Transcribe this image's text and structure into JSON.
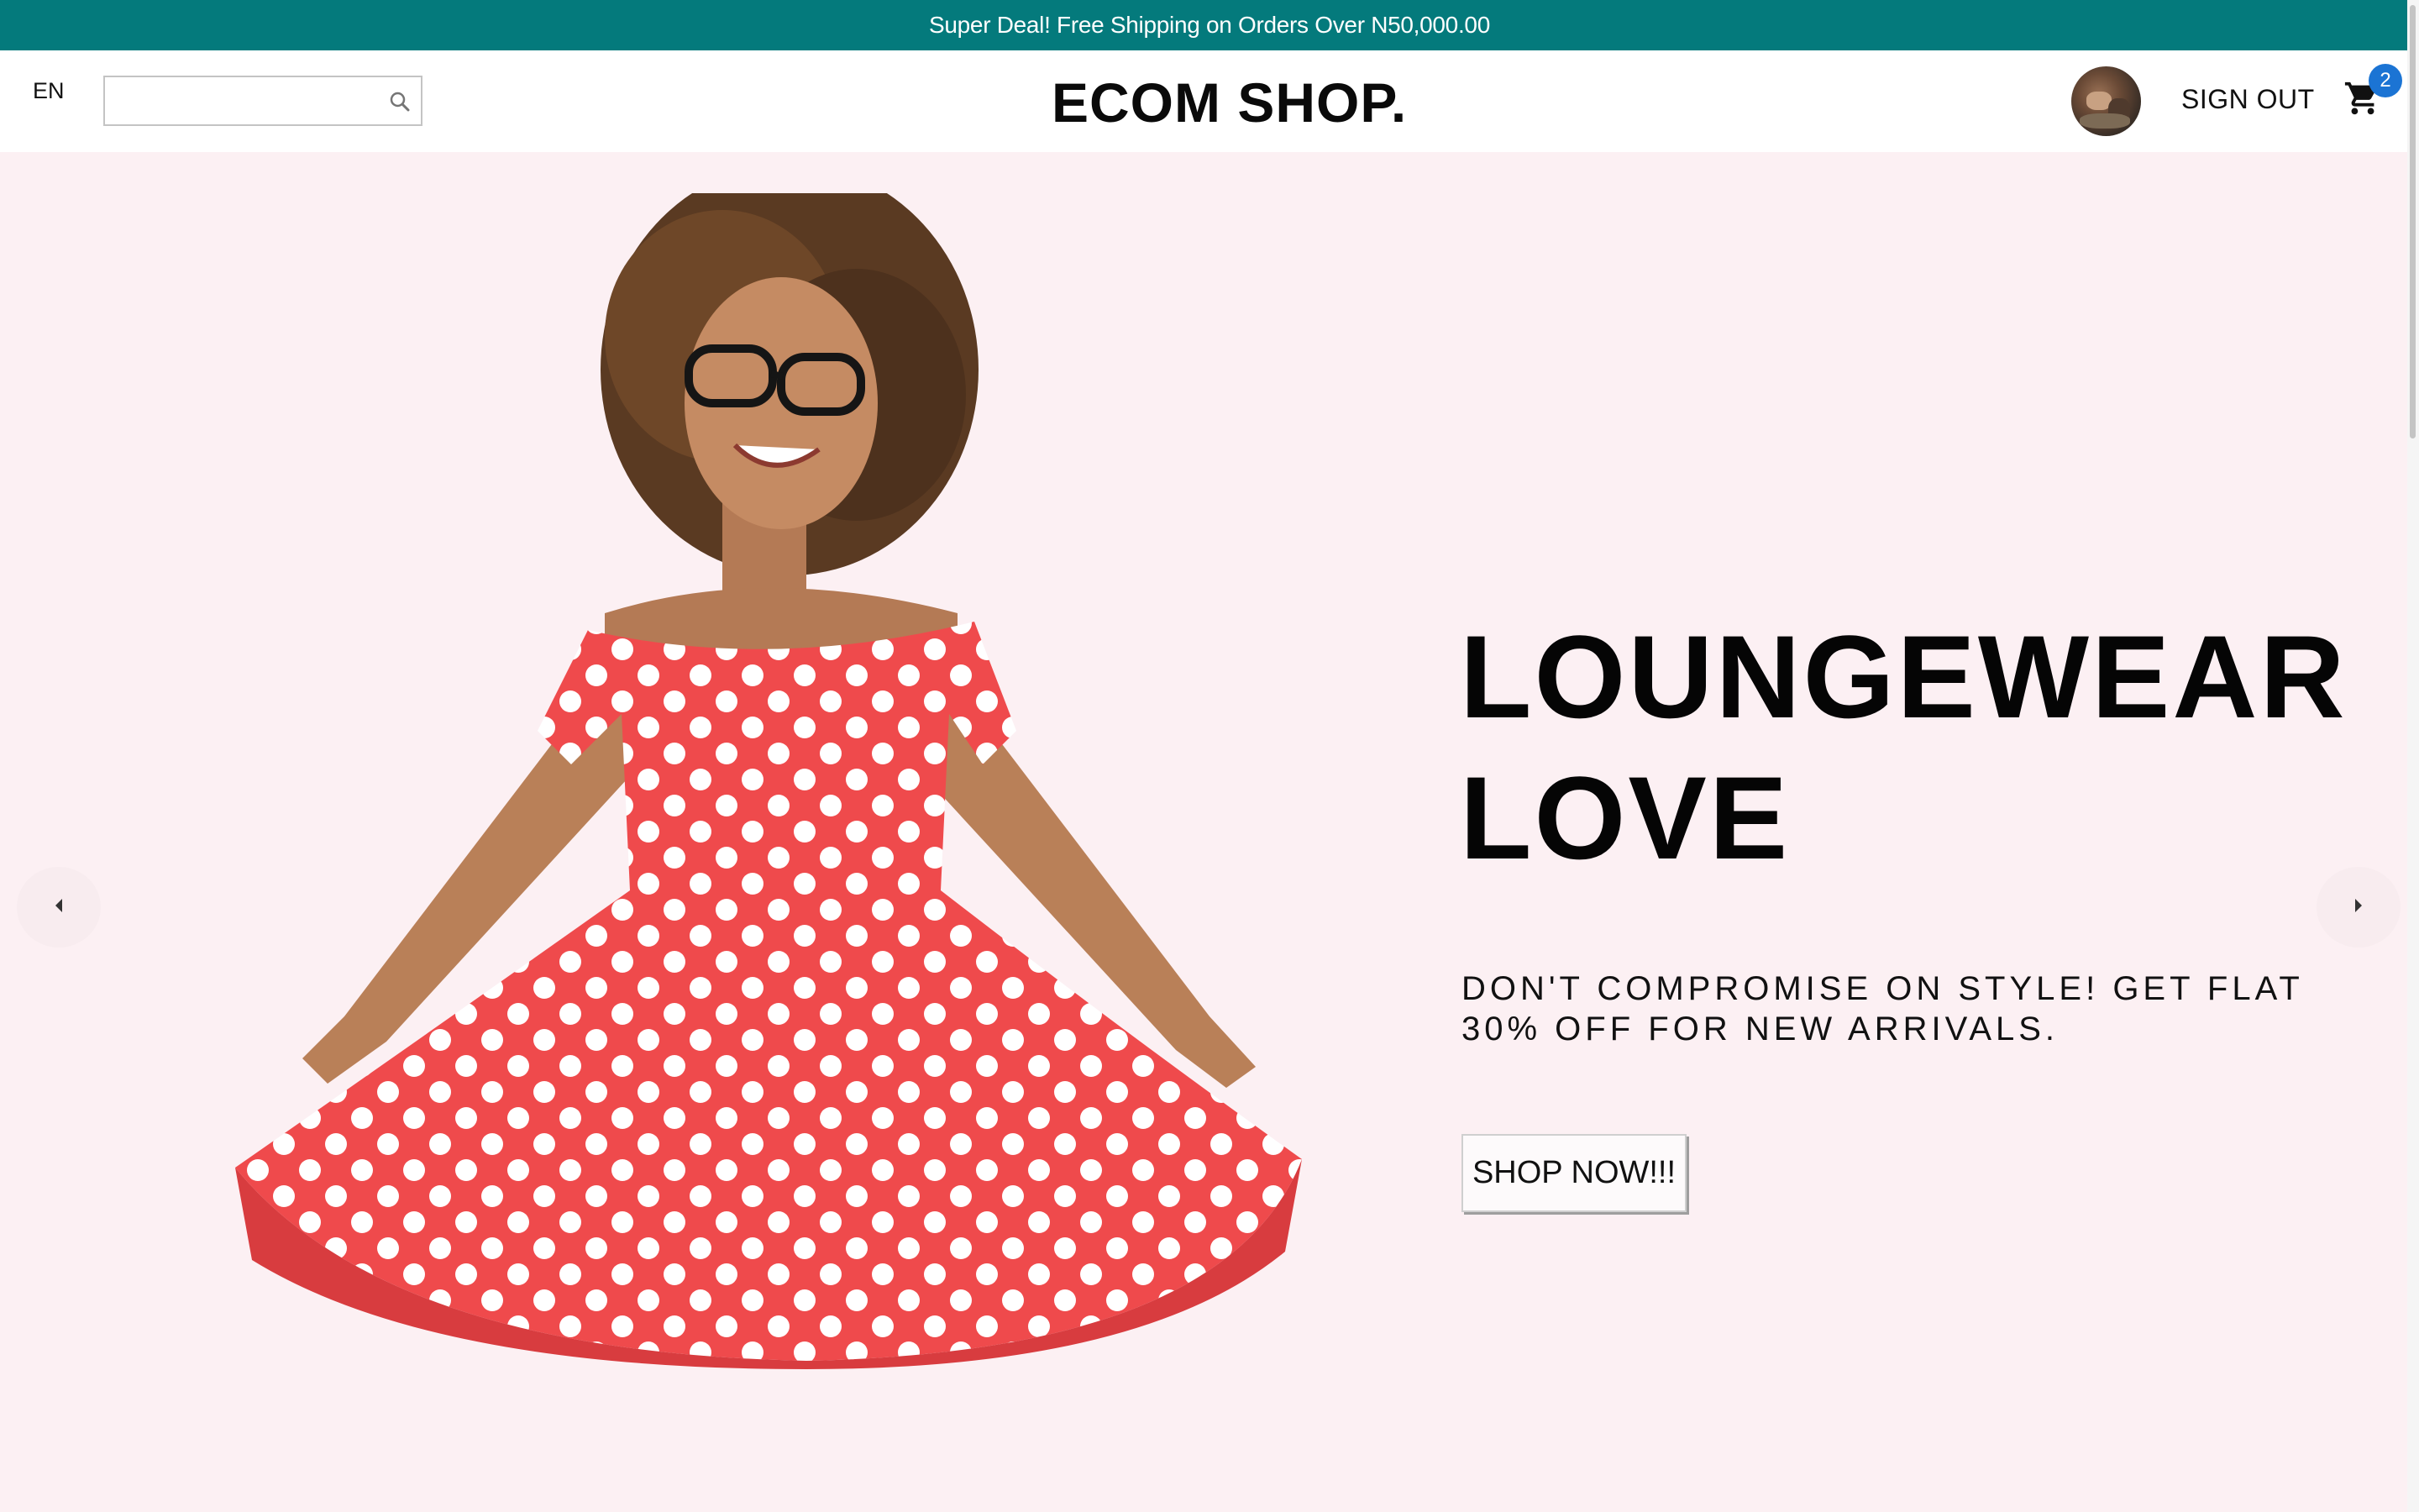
{
  "promo": {
    "text": "Super Deal! Free Shipping on Orders Over N50,000.00"
  },
  "header": {
    "language": "EN",
    "search": {
      "placeholder": "",
      "value": ""
    },
    "logo": "ECOM SHOP.",
    "sign_out_label": "SIGN OUT",
    "cart_count": "2"
  },
  "hero": {
    "title_line1": "LOUNGEWEAR",
    "title_line2": "LOVE",
    "subtitle_line1": "DON'T COMPROMISE ON STYLE! GET FLAT",
    "subtitle_line2": "30% OFF FOR NEW ARRIVALS.",
    "cta_label": "SHOP NOW!!!"
  },
  "colors": {
    "promo_bg": "#047a7c",
    "hero_bg": "#fcf0f3",
    "badge": "#1b74d4",
    "dress": "#ef4a4c"
  },
  "icons": {
    "search": "search-icon",
    "cart": "cart-icon",
    "prev": "chevron-left-icon",
    "next": "chevron-right-icon"
  }
}
